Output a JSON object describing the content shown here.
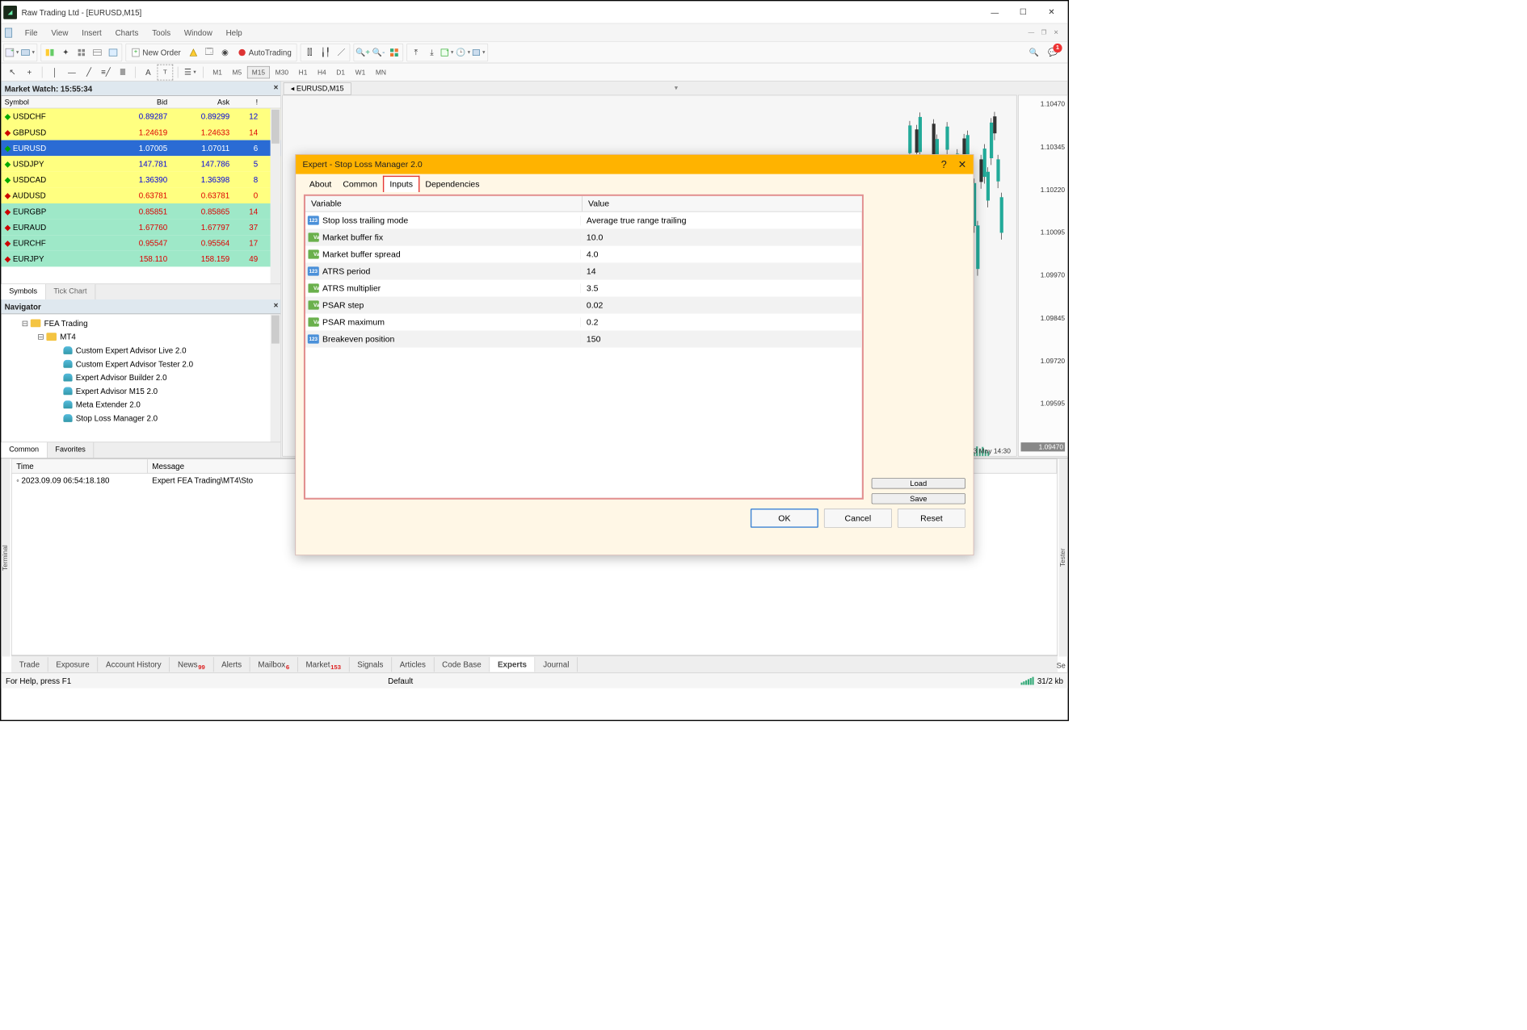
{
  "titlebar": {
    "title": "Raw Trading Ltd - [EURUSD,M15]"
  },
  "menu": {
    "items": [
      "File",
      "View",
      "Insert",
      "Charts",
      "Tools",
      "Window",
      "Help"
    ]
  },
  "toolbar": {
    "newOrder": "New Order",
    "autoTrading": "AutoTrading",
    "badge": "1"
  },
  "timeframes": [
    "M1",
    "M5",
    "M15",
    "M30",
    "H1",
    "H4",
    "D1",
    "W1",
    "MN"
  ],
  "marketWatch": {
    "title": "Market Watch: 15:55:34",
    "cols": [
      "Symbol",
      "Bid",
      "Ask",
      "!"
    ],
    "rows": [
      {
        "sym": "USDCHF",
        "bid": "0.89287",
        "ask": "0.89299",
        "sp": "12",
        "cls": "yellow",
        "dir": "up",
        "col": "bluec"
      },
      {
        "sym": "GBPUSD",
        "bid": "1.24619",
        "ask": "1.24633",
        "sp": "14",
        "cls": "yellow",
        "dir": "dn",
        "col": "red"
      },
      {
        "sym": "EURUSD",
        "bid": "1.07005",
        "ask": "1.07011",
        "sp": "6",
        "cls": "blue",
        "dir": "up",
        "col": ""
      },
      {
        "sym": "USDJPY",
        "bid": "147.781",
        "ask": "147.786",
        "sp": "5",
        "cls": "yellow",
        "dir": "up",
        "col": "bluec"
      },
      {
        "sym": "USDCAD",
        "bid": "1.36390",
        "ask": "1.36398",
        "sp": "8",
        "cls": "yellow",
        "dir": "up",
        "col": "bluec"
      },
      {
        "sym": "AUDUSD",
        "bid": "0.63781",
        "ask": "0.63781",
        "sp": "0",
        "cls": "yellow",
        "dir": "dn",
        "col": "red"
      },
      {
        "sym": "EURGBP",
        "bid": "0.85851",
        "ask": "0.85865",
        "sp": "14",
        "cls": "green",
        "dir": "dn",
        "col": "red"
      },
      {
        "sym": "EURAUD",
        "bid": "1.67760",
        "ask": "1.67797",
        "sp": "37",
        "cls": "green",
        "dir": "dn",
        "col": "red"
      },
      {
        "sym": "EURCHF",
        "bid": "0.95547",
        "ask": "0.95564",
        "sp": "17",
        "cls": "green",
        "dir": "dn",
        "col": "red"
      },
      {
        "sym": "EURJPY",
        "bid": "158.110",
        "ask": "158.159",
        "sp": "49",
        "cls": "green",
        "dir": "dn",
        "col": "red"
      }
    ],
    "tabs": [
      "Symbols",
      "Tick Chart"
    ]
  },
  "navigator": {
    "title": "Navigator",
    "root": "FEA Trading",
    "sub": "MT4",
    "items": [
      "Custom Expert Advisor Live 2.0",
      "Custom Expert Advisor Tester 2.0",
      "Expert Advisor Builder 2.0",
      "Expert Advisor M15 2.0",
      "Meta Extender 2.0",
      "Stop Loss Manager 2.0"
    ],
    "tabs": [
      "Common",
      "Favorites"
    ]
  },
  "chart": {
    "tab": "EURUSD,M15",
    "prices": [
      "1.10470",
      "1.10345",
      "1.10220",
      "1.10095",
      "1.09970",
      "1.09845",
      "1.09720",
      "1.09595",
      "1.09470"
    ],
    "current": "1.09470",
    "timeLabel": "3 May 14:30"
  },
  "terminal": {
    "cols": [
      "Time",
      "Message"
    ],
    "row": {
      "time": "2023.09.09 06:54:18.180",
      "msg": "Expert FEA Trading\\MT4\\Sto"
    },
    "tabs": [
      {
        "l": "Trade"
      },
      {
        "l": "Exposure"
      },
      {
        "l": "Account History"
      },
      {
        "l": "News",
        "c": "99"
      },
      {
        "l": "Alerts"
      },
      {
        "l": "Mailbox",
        "c": "6"
      },
      {
        "l": "Market",
        "c": "153"
      },
      {
        "l": "Signals"
      },
      {
        "l": "Articles"
      },
      {
        "l": "Code Base"
      },
      {
        "l": "Experts",
        "active": true
      },
      {
        "l": "Journal"
      }
    ],
    "sideL": "Terminal",
    "sideR": "Tester",
    "sideR2": "Se"
  },
  "status": {
    "left": "For Help, press F1",
    "mid": "Default",
    "right": "31/2 kb"
  },
  "dialog": {
    "title": "Expert - Stop Loss Manager 2.0",
    "tabs": [
      "About",
      "Common",
      "Inputs",
      "Dependencies"
    ],
    "head": [
      "Variable",
      "Value"
    ],
    "rows": [
      {
        "ico": "num",
        "var": "Stop loss trailing mode",
        "val": "Average true range trailing"
      },
      {
        "ico": "val",
        "var": "Market buffer fix",
        "val": "10.0"
      },
      {
        "ico": "val",
        "var": "Market buffer spread",
        "val": "4.0"
      },
      {
        "ico": "num",
        "var": "ATRS period",
        "val": "14"
      },
      {
        "ico": "val",
        "var": "ATRS multiplier",
        "val": "3.5"
      },
      {
        "ico": "val",
        "var": "PSAR step",
        "val": "0.02"
      },
      {
        "ico": "val",
        "var": "PSAR maximum",
        "val": "0.2"
      },
      {
        "ico": "num",
        "var": "Breakeven position",
        "val": "150"
      }
    ],
    "btnLoad": "Load",
    "btnSave": "Save",
    "btnOK": "OK",
    "btnCancel": "Cancel",
    "btnReset": "Reset"
  }
}
